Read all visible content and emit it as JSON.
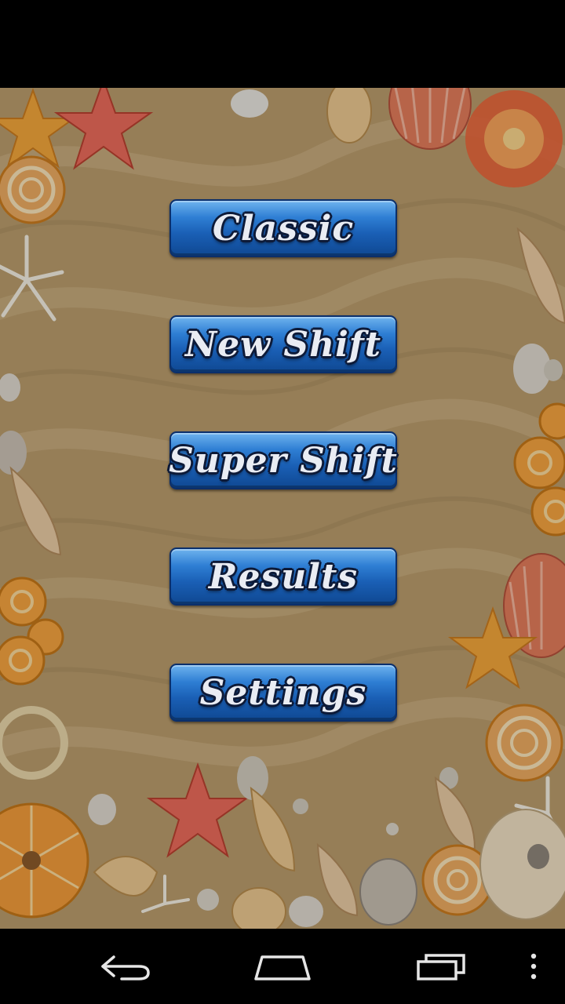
{
  "menu": {
    "items": [
      {
        "label": "Classic"
      },
      {
        "label": "New Shift"
      },
      {
        "label": "Super Shift"
      },
      {
        "label": "Results"
      },
      {
        "label": "Settings"
      }
    ]
  },
  "colors": {
    "sand": "#b79a6b",
    "button_blue": "#1a5fb5",
    "button_text": "#e9ecf3",
    "starfish_orange": "#f0a43a",
    "starfish_red": "#e25a4a",
    "shell_cream": "#e8d2a8"
  },
  "navigation": {
    "icons": [
      "back-icon",
      "home-icon",
      "recent-apps-icon",
      "overflow-menu-icon"
    ]
  }
}
